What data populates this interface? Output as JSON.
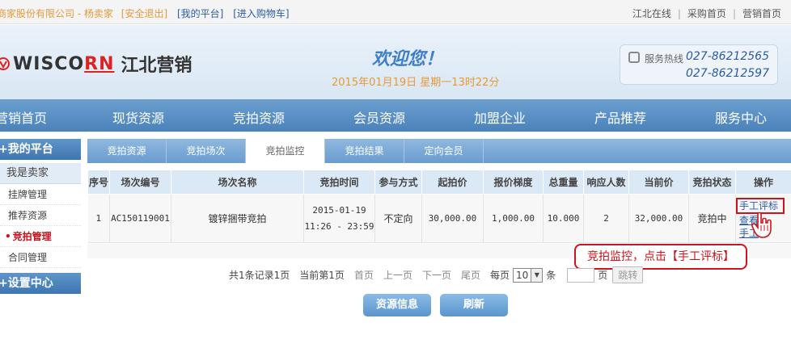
{
  "topbar": {
    "company": "商家股份有限公司 - 杨卖家",
    "logout": "[安全退出]",
    "my_platform": "[我的平台]",
    "cart": "[进入购物车]",
    "right_links": [
      "江北在线",
      "采购首页",
      "营销首页"
    ]
  },
  "header": {
    "brand_en": "WISCO",
    "brand_en_red": "RN",
    "brand_cn": "江北营销",
    "welcome": "欢迎您！",
    "date": "2015年01月19日 星期一13时22分",
    "hotline_label": "服务热线",
    "hotline_1": "027-86212565",
    "hotline_2": "027-86212597"
  },
  "mainnav": [
    "营销首页",
    "现货资源",
    "竞拍资源",
    "会员资源",
    "加盟企业",
    "产品推荐",
    "服务中心"
  ],
  "sidebar": {
    "platform_head": "+我的平台",
    "seller": "我是卖家",
    "items": [
      "挂牌管理",
      "推荐资源",
      "竞拍管理",
      "合同管理"
    ],
    "settings_head": "+设置中心"
  },
  "tabs": [
    "竞拍资源",
    "竞拍场次",
    "竞拍监控",
    "竞拍结果",
    "定向会员"
  ],
  "table": {
    "headers": [
      "序号",
      "场次编号",
      "场次名称",
      "竞拍时间",
      "参与方式",
      "起拍价",
      "报价梯度",
      "总重量",
      "响应人数",
      "当前价",
      "竞拍状态",
      "操作"
    ],
    "row": {
      "no": "1",
      "code": "AC150119001",
      "name": "镀锌捆带竞拍",
      "date": "2015-01-19",
      "time": "11:26 - 23:59",
      "mode": "不定向",
      "start_price": "30,000.00",
      "step": "1,000.00",
      "weight": "10.000",
      "responders": "2",
      "current_price": "32,000.00",
      "status": "竞拍中",
      "ops": [
        "手工评标",
        "查看",
        "手工"
      ]
    }
  },
  "callout": "竞拍监控，点击【手工评标】",
  "pager": {
    "summary": "共1条记录1页",
    "current": "当前第1页",
    "first": "首页",
    "prev": "上一页",
    "next": "下一页",
    "last": "尾页",
    "per_page": "每页",
    "per_value": "10",
    "unit": "条",
    "page_unit": "页",
    "jump": "跳转"
  },
  "buttons": {
    "info": "资源信息",
    "refresh": "刷新"
  },
  "colors": {
    "accent_blue": "#4a82bb",
    "highlight_red": "#d0121a",
    "orange": "#e49a3a"
  }
}
